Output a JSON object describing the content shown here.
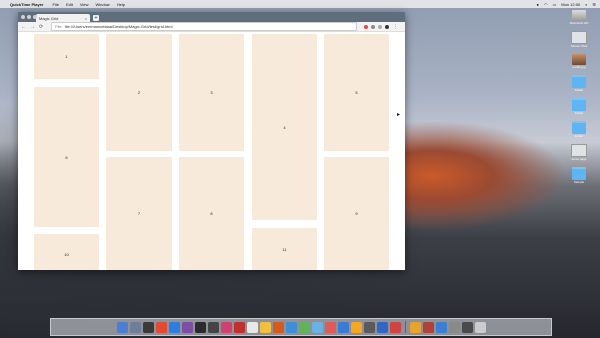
{
  "menubar": {
    "apple": "",
    "app": "QuickTime Player",
    "items": [
      "File",
      "Edit",
      "View",
      "Window",
      "Help"
    ],
    "clock": "Mon 12:00"
  },
  "desktop_icons": [
    {
      "label": "Macintosh HD",
      "kind": "disk"
    },
    {
      "label": "Screen Shot",
      "kind": "ssimg"
    },
    {
      "label": "profile.jpg",
      "kind": "photo"
    },
    {
      "label": "Folder",
      "kind": "folder"
    },
    {
      "label": "Folder",
      "kind": "folder"
    },
    {
      "label": "Folder",
      "kind": "folder"
    },
    {
      "label": "demo page",
      "kind": "ssimg"
    },
    {
      "label": "Sample",
      "kind": "folder"
    }
  ],
  "browser": {
    "tab_title": "Magic Grid",
    "tab_close": "×",
    "new_tab": "+",
    "address_prefix": "File",
    "address": "file:///Users/emmanuelstaa/Desktop/Magic-Grid/test/grid.html"
  },
  "grid": {
    "cards": [
      "1",
      "2",
      "3",
      "4",
      "5",
      "6",
      "7",
      "8",
      "9",
      "10",
      "11",
      "12"
    ]
  },
  "dock": {
    "colors": [
      "#4a7fd1",
      "#6c7f9a",
      "#3a3a3a",
      "#e24a31",
      "#2f7de0",
      "#7d4ea2",
      "#2b2b2b",
      "#444",
      "#d04070",
      "#c03030",
      "#e8e8e8",
      "#f0c040",
      "#d45a1f",
      "#3e8ed6",
      "#5fb35a",
      "#6ab1e4",
      "#e05a5a",
      "#3b7bd4",
      "#f5a623",
      "#5a5a5a",
      "#2f67c9",
      "#c44",
      "#e8a32f",
      "#b0403a",
      "#3b7fd4",
      "#8a8a8a",
      "#4a4a4a",
      "#ccc"
    ],
    "trash": "trash-icon"
  }
}
